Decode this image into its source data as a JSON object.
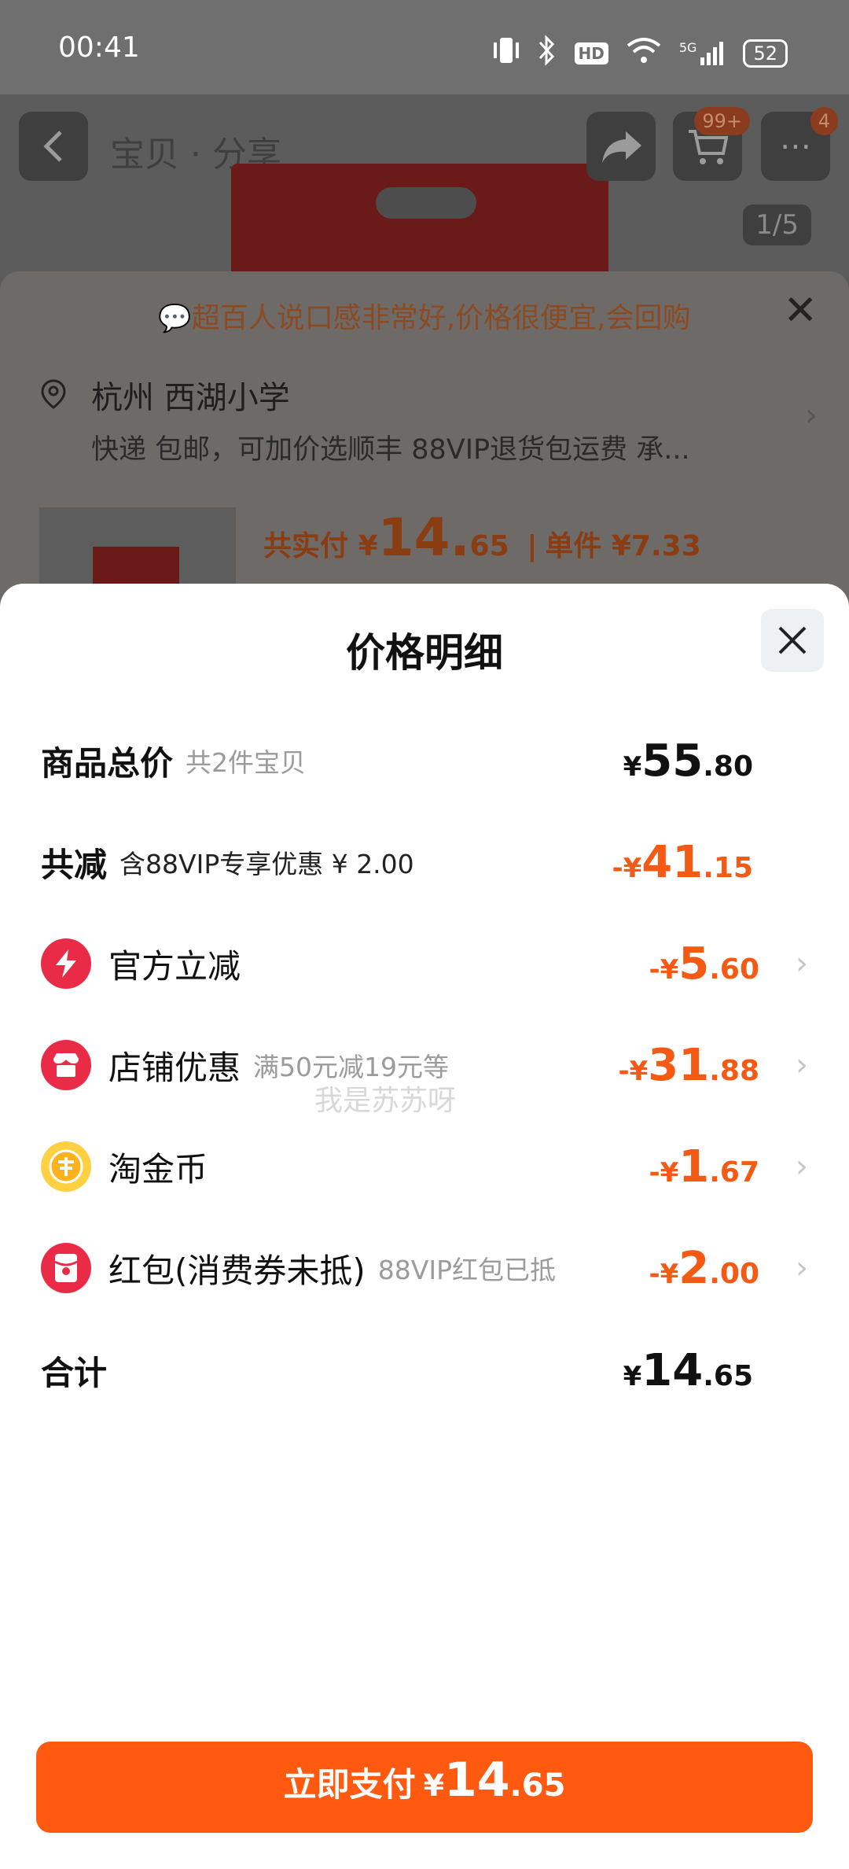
{
  "status_bar": {
    "time": "00:41",
    "network": "5G",
    "hd": "HD",
    "battery": "52"
  },
  "background_page": {
    "title": "宝贝 · 分享",
    "cart_badge": "99+",
    "more_badge": "4",
    "pager": "1/5",
    "banner": "超百人说口感非常好,价格很便宜,会回购",
    "location": "杭州 西湖小学",
    "shipping": "快递 包邮，可加价选顺丰 88VIP退货包运费 承...",
    "price_prefix": "共实付",
    "price_symbol": "¥",
    "price_int": "14.",
    "price_dec": "65",
    "unit_label": "单件 ¥7.33"
  },
  "modal": {
    "title": "价格明细",
    "watermark": "我是苏苏呀",
    "rows": [
      {
        "label": "商品总价",
        "note": "共2件宝贝",
        "sym": "¥",
        "int": "55",
        "dec": ".80"
      },
      {
        "label": "共减",
        "note": "含88VIP专享优惠 ¥ 2.00",
        "sym": "-¥",
        "int": "41",
        "dec": ".15"
      },
      {
        "label": "官方立减",
        "note": "",
        "sym": "-¥",
        "int": "5",
        "dec": ".60",
        "icon": "lightning-icon"
      },
      {
        "label": "店铺优惠",
        "note": "满50元减19元等",
        "sym": "-¥",
        "int": "31",
        "dec": ".88",
        "icon": "shop-icon"
      },
      {
        "label": "淘金币",
        "note": "",
        "sym": "-¥",
        "int": "1",
        "dec": ".67",
        "icon": "coin-icon"
      },
      {
        "label": "红包(消费券未抵)",
        "note": "88VIP红包已抵",
        "sym": "-¥",
        "int": "2",
        "dec": ".00",
        "icon": "red-packet-icon"
      },
      {
        "label": "合计",
        "note": "",
        "sym": "¥",
        "int": "14",
        "dec": ".65"
      }
    ],
    "pay_button": {
      "label": "立即支付",
      "sym": "¥",
      "int": "14",
      "dec": ".65"
    }
  }
}
